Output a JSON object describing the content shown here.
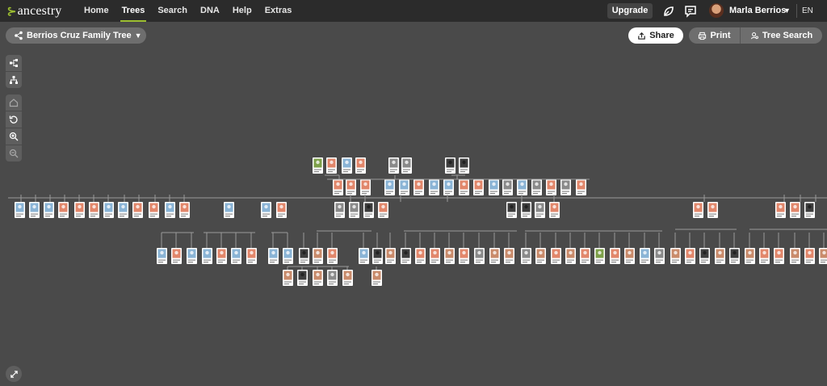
{
  "nav": {
    "logo_text": "ancestry",
    "items": [
      {
        "label": "Home",
        "active": false
      },
      {
        "label": "Trees",
        "active": true
      },
      {
        "label": "Search",
        "active": false
      },
      {
        "label": "DNA",
        "active": false
      },
      {
        "label": "Help",
        "active": false
      },
      {
        "label": "Extras",
        "active": false
      }
    ],
    "upgrade_label": "Upgrade",
    "user_name": "Marla Berrios",
    "language": "EN",
    "icons": [
      "hint-leaf-icon",
      "messages-icon",
      "avatar",
      "chevron-down-icon"
    ]
  },
  "toolbar": {
    "tree_name": "Berrios Cruz Family Tree",
    "share_label": "Share",
    "print_label": "Print",
    "tree_search_label": "Tree Search"
  },
  "tools": [
    "family-view-icon",
    "pedigree-view-icon",
    "home-person-icon",
    "reset-icon",
    "zoom-in-icon",
    "zoom-out-icon",
    "fullscreen-icon"
  ],
  "colors": {
    "accent_green": "#9cbe30",
    "female_card": "#e2876b",
    "male_card": "#8ab4d6",
    "canvas_bg": "#4a4a4a",
    "nav_bg": "#2b2b2b"
  }
}
